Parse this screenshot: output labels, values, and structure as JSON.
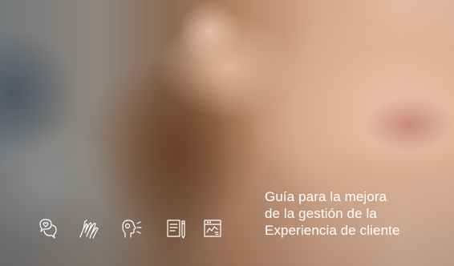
{
  "cover": {
    "title_lines": [
      "Guía para la mejora",
      "de la gestión de la",
      "Experiencia de cliente"
    ],
    "icons": [
      "chat-heart-icon",
      "hands-icon",
      "head-profile-sound-icon",
      "document-pencil-icon",
      "dashboard-panel-icon"
    ],
    "text_color": "#ffffff"
  }
}
